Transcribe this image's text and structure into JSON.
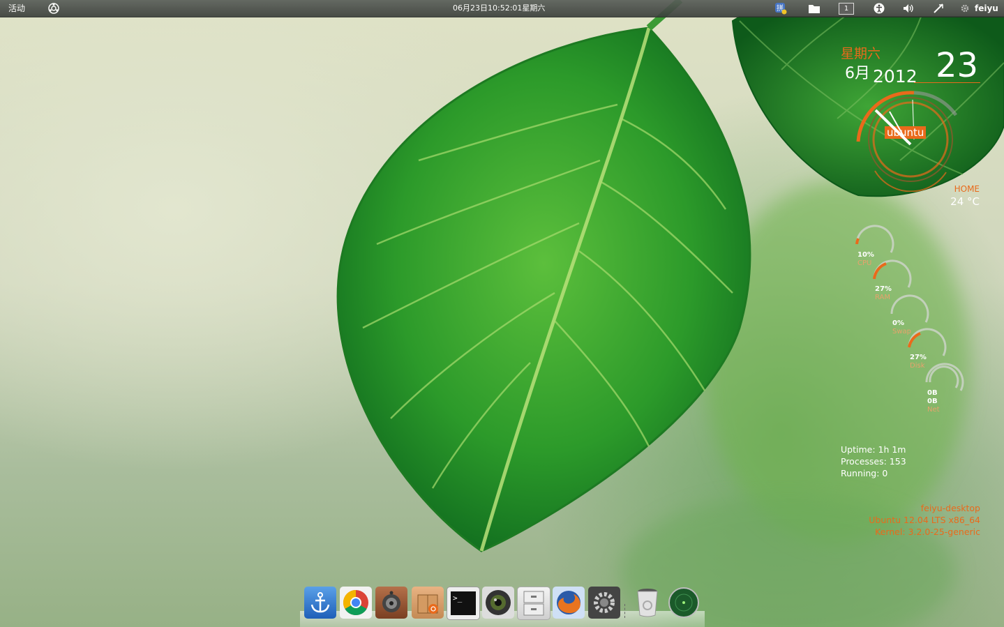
{
  "topbar": {
    "activities": "活动",
    "datetime": "06月23日10:52:01星期六",
    "workspace": "1",
    "user": "feiyu",
    "icons": [
      "ubuntu-icon",
      "input-method-icon",
      "folder-icon",
      "workspace-indicator",
      "accessibility-icon",
      "volume-icon",
      "network-icon",
      "gear-icon"
    ]
  },
  "clock_widget": {
    "weekday": "星期六",
    "month": "6月",
    "year": "2012",
    "day": "23",
    "logo": "ubuntu",
    "location": "HOME",
    "temperature": "24 °C"
  },
  "rings": [
    {
      "value": "10%",
      "name": "CPU",
      "percent": 10
    },
    {
      "value": "27%",
      "name": "RAM",
      "percent": 27
    },
    {
      "value": "0%",
      "name": "Swap",
      "percent": 0
    },
    {
      "value": "27%",
      "name": "Disk",
      "percent": 27
    },
    {
      "value": "0B",
      "value2": "0B",
      "name": "Net",
      "percent": 0
    }
  ],
  "system": {
    "uptime": "Uptime: 1h 1m",
    "processes": "Processes: 153",
    "running": "Running: 0"
  },
  "host": {
    "name": "feiyu-desktop",
    "os": "Ubuntu 12.04 LTS x86_64",
    "kernel": "Kernel: 3.2.0-25-generic"
  },
  "dock": {
    "items": [
      "anchor-icon",
      "chrome-icon",
      "speaker-icon",
      "package-icon",
      "terminal-icon",
      "webcam-icon",
      "file-cabinet-icon",
      "firefox-icon",
      "system-settings-icon",
      "trash-icon",
      "radar-icon"
    ],
    "terminal_prompt": ">_"
  },
  "colors": {
    "accent": "#e96a1b",
    "panel": "#3b3f3b",
    "leaf": "#2f8f2f"
  }
}
